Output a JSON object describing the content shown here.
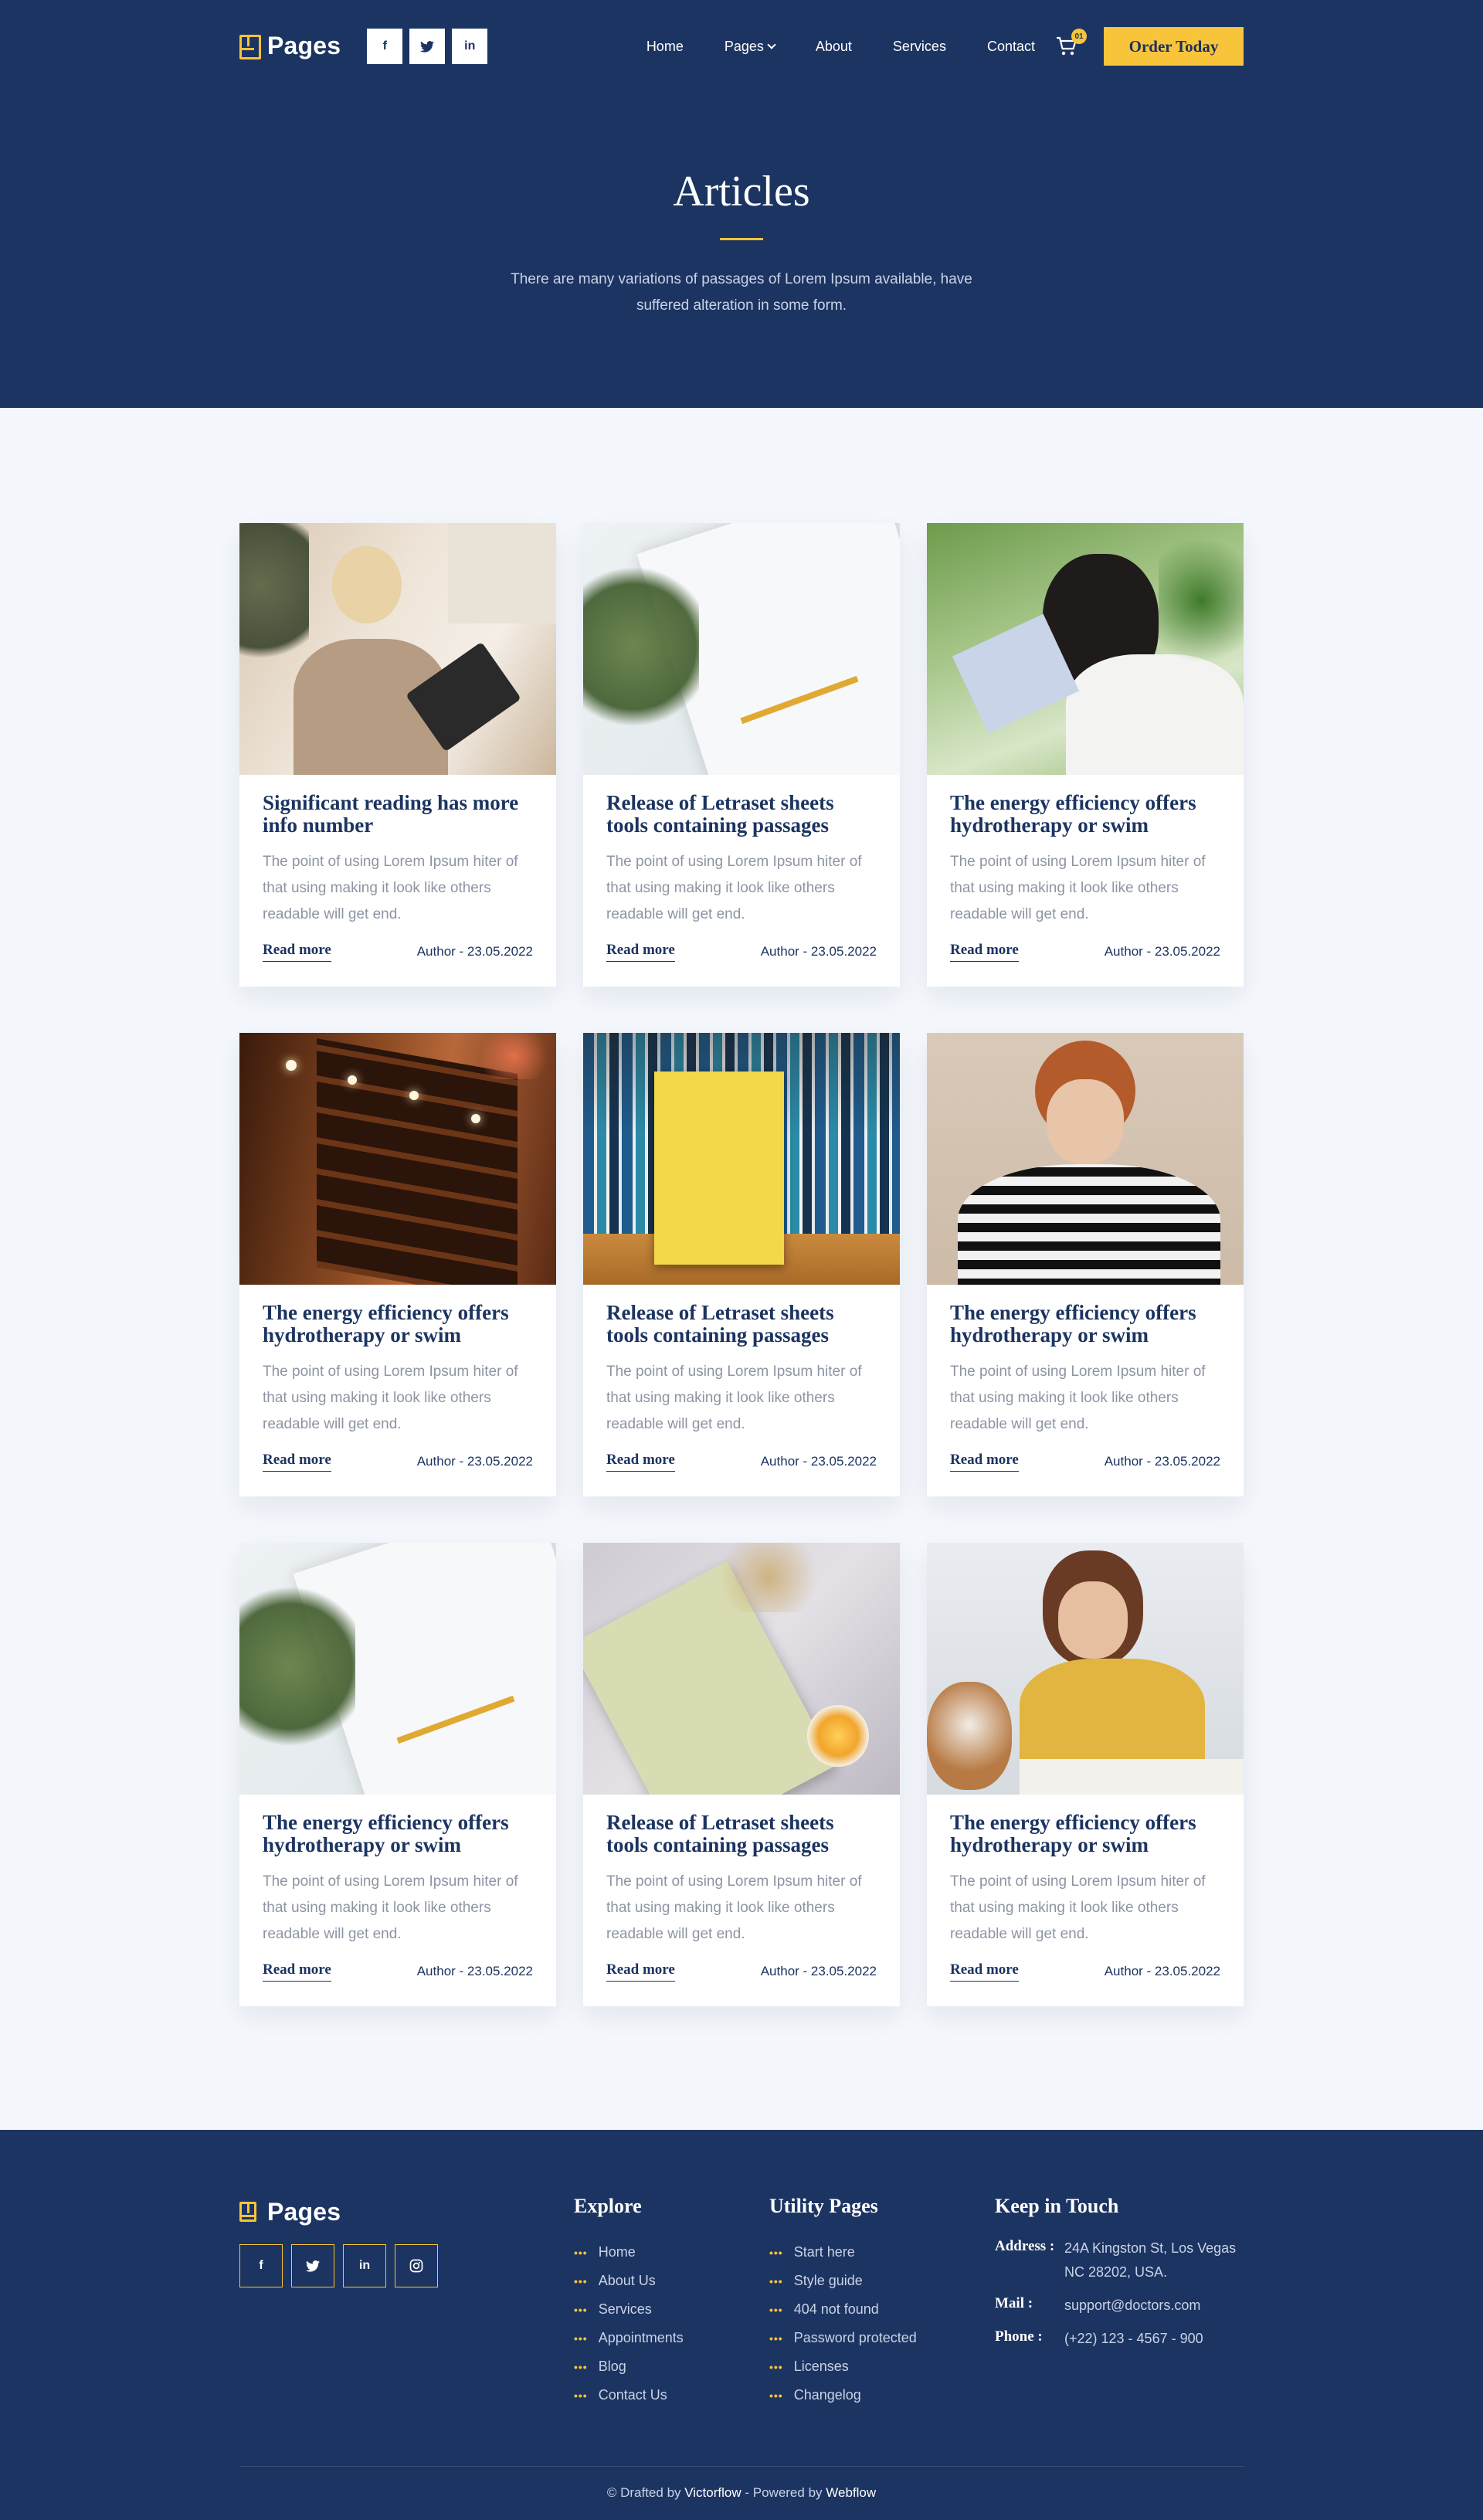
{
  "header": {
    "brand": "Pages",
    "socials": [
      {
        "icon": "facebook-icon",
        "glyph": "f"
      },
      {
        "icon": "twitter-icon",
        "glyph": "t"
      },
      {
        "icon": "linkedin-icon",
        "glyph": "in"
      }
    ],
    "menu": {
      "home": "Home",
      "pages": "Pages",
      "about": "About",
      "services": "Services",
      "contact": "Contact"
    },
    "cart_count": "01",
    "order_button": "Order Today"
  },
  "hero": {
    "title": "Articles",
    "description": "There are many variations of passages of Lorem Ipsum available,  have suffered alteration in some form."
  },
  "articles": [
    {
      "title": "Significant reading has more info number",
      "text": "The point of using Lorem Ipsum hiter of that using making it look like others readable will get end.",
      "read_more": "Read more",
      "meta": "Author - 23.05.2022"
    },
    {
      "title": "Release of Letraset sheets tools containing  passages",
      "text": "The point of using Lorem Ipsum hiter of that using making it look like others readable will get end.",
      "read_more": "Read more",
      "meta": "Author - 23.05.2022"
    },
    {
      "title": "The energy efficiency offers hydrotherapy or swim",
      "text": "The point of using Lorem Ipsum hiter of that using making it look like others readable will get end.",
      "read_more": "Read more",
      "meta": "Author - 23.05.2022"
    },
    {
      "title": "The energy efficiency offers hydrotherapy or swim",
      "text": "The point of using Lorem Ipsum hiter of that using making it look like others readable will get end.",
      "read_more": "Read more",
      "meta": "Author - 23.05.2022"
    },
    {
      "title": "Release of Letraset sheets tools containing  passages",
      "text": "The point of using Lorem Ipsum hiter of that using making it look like others readable will get end.",
      "read_more": "Read more",
      "meta": "Author - 23.05.2022"
    },
    {
      "title": "The energy efficiency offers hydrotherapy or swim",
      "text": "The point of using Lorem Ipsum hiter of that using making it look like others readable will get end.",
      "read_more": "Read more",
      "meta": "Author - 23.05.2022"
    },
    {
      "title": "The energy efficiency offers hydrotherapy or swim",
      "text": "The point of using Lorem Ipsum hiter of that using making it look like others readable will get end.",
      "read_more": "Read more",
      "meta": "Author - 23.05.2022"
    },
    {
      "title": "Release of Letraset sheets tools containing  passages",
      "text": "The point of using Lorem Ipsum hiter of that using making it look like others readable will get end.",
      "read_more": "Read more",
      "meta": "Author - 23.05.2022"
    },
    {
      "title": "The energy efficiency offers hydrotherapy or swim",
      "text": "The point of using Lorem Ipsum hiter of that using making it look like others readable will get end.",
      "read_more": "Read more",
      "meta": "Author - 23.05.2022"
    }
  ],
  "footer": {
    "brand": "Pages",
    "socials": [
      "facebook-icon",
      "twitter-icon",
      "linkedin-icon",
      "instagram-icon"
    ],
    "explore": {
      "title": "Explore",
      "items": [
        "Home",
        "About Us",
        "Services",
        "Appointments",
        "Blog",
        "Contact Us"
      ]
    },
    "utility": {
      "title": "Utility Pages",
      "items": [
        "Start here",
        "Style guide",
        "404 not found",
        "Password protected",
        "Licenses",
        "Changelog"
      ]
    },
    "contact": {
      "title": "Keep in Touch",
      "address_label": "Address :",
      "address_value": "24A Kingston St, Los Vegas NC 28202, USA.",
      "mail_label": "Mail :",
      "mail_value": "support@doctors.com",
      "phone_label": "Phone :",
      "phone_value": "(+22) 123 - 4567 - 900"
    },
    "bottom": {
      "prefix": "© Drafted by ",
      "author": "Victorflow",
      "middle": " - Powered by ",
      "platform": "Webflow"
    }
  },
  "colors": {
    "navy": "#1c3461",
    "accent": "#f7c43a",
    "background": "#f4f7fb"
  }
}
